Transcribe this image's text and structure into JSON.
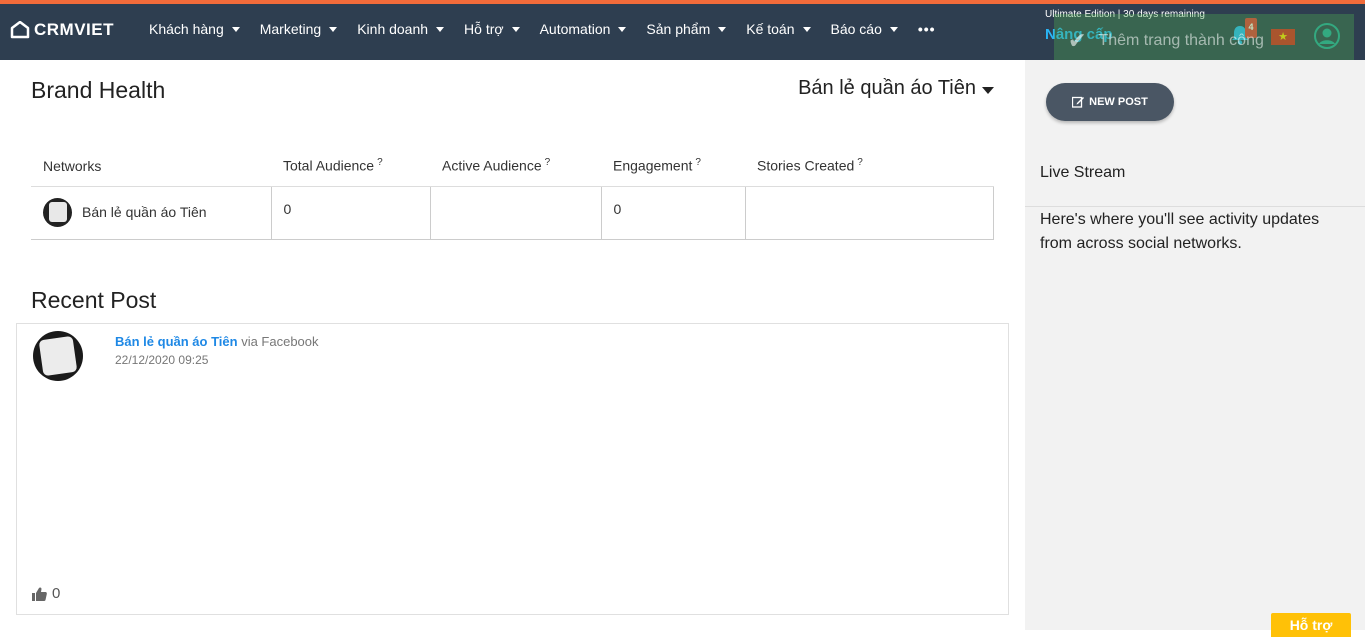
{
  "header": {
    "logo_text": "CRMVIET",
    "nav": [
      {
        "label": "Khách hàng",
        "has_caret": true
      },
      {
        "label": "Marketing",
        "has_caret": true
      },
      {
        "label": "Kinh doanh",
        "has_caret": true
      },
      {
        "label": "Hỗ trợ",
        "has_caret": true
      },
      {
        "label": "Automation",
        "has_caret": true
      },
      {
        "label": "Sản phẩm",
        "has_caret": true
      },
      {
        "label": "Kế toán",
        "has_caret": true
      },
      {
        "label": "Báo cáo",
        "has_caret": true
      }
    ],
    "more_label": "•••",
    "edition_text": "Ultimate Edition | 30 days remaining",
    "upgrade_label": "Nâng cấp",
    "notification_count": "4",
    "flag_star": "★",
    "toast_text": "Thêm trang thành công",
    "accent_color": "#f26b3a",
    "bar_color": "#2e3e50"
  },
  "brand_health": {
    "title": "Brand Health",
    "selected_page": "Bán lẻ quần áo Tiên",
    "columns": [
      {
        "label": "Networks",
        "help": ""
      },
      {
        "label": "Total Audience",
        "help": "?"
      },
      {
        "label": "Active Audience",
        "help": "?"
      },
      {
        "label": "Engagement",
        "help": "?"
      },
      {
        "label": "Stories Created",
        "help": "?"
      }
    ],
    "rows": [
      {
        "network": "Bán lẻ quần áo Tiên",
        "total_audience": "0",
        "active_audience": "",
        "engagement": "0",
        "stories_created": ""
      }
    ]
  },
  "recent_post": {
    "title": "Recent Post",
    "author": "Bán lẻ quần áo Tiên",
    "via": "via Facebook",
    "timestamp": "22/12/2020 09:25",
    "likes": "0"
  },
  "sidebar": {
    "new_post_label": "NEW POST",
    "live_stream_title": "Live Stream",
    "live_stream_message": "Here's where you'll see activity updates from across social networks."
  },
  "support_label": "Hỗ trợ"
}
